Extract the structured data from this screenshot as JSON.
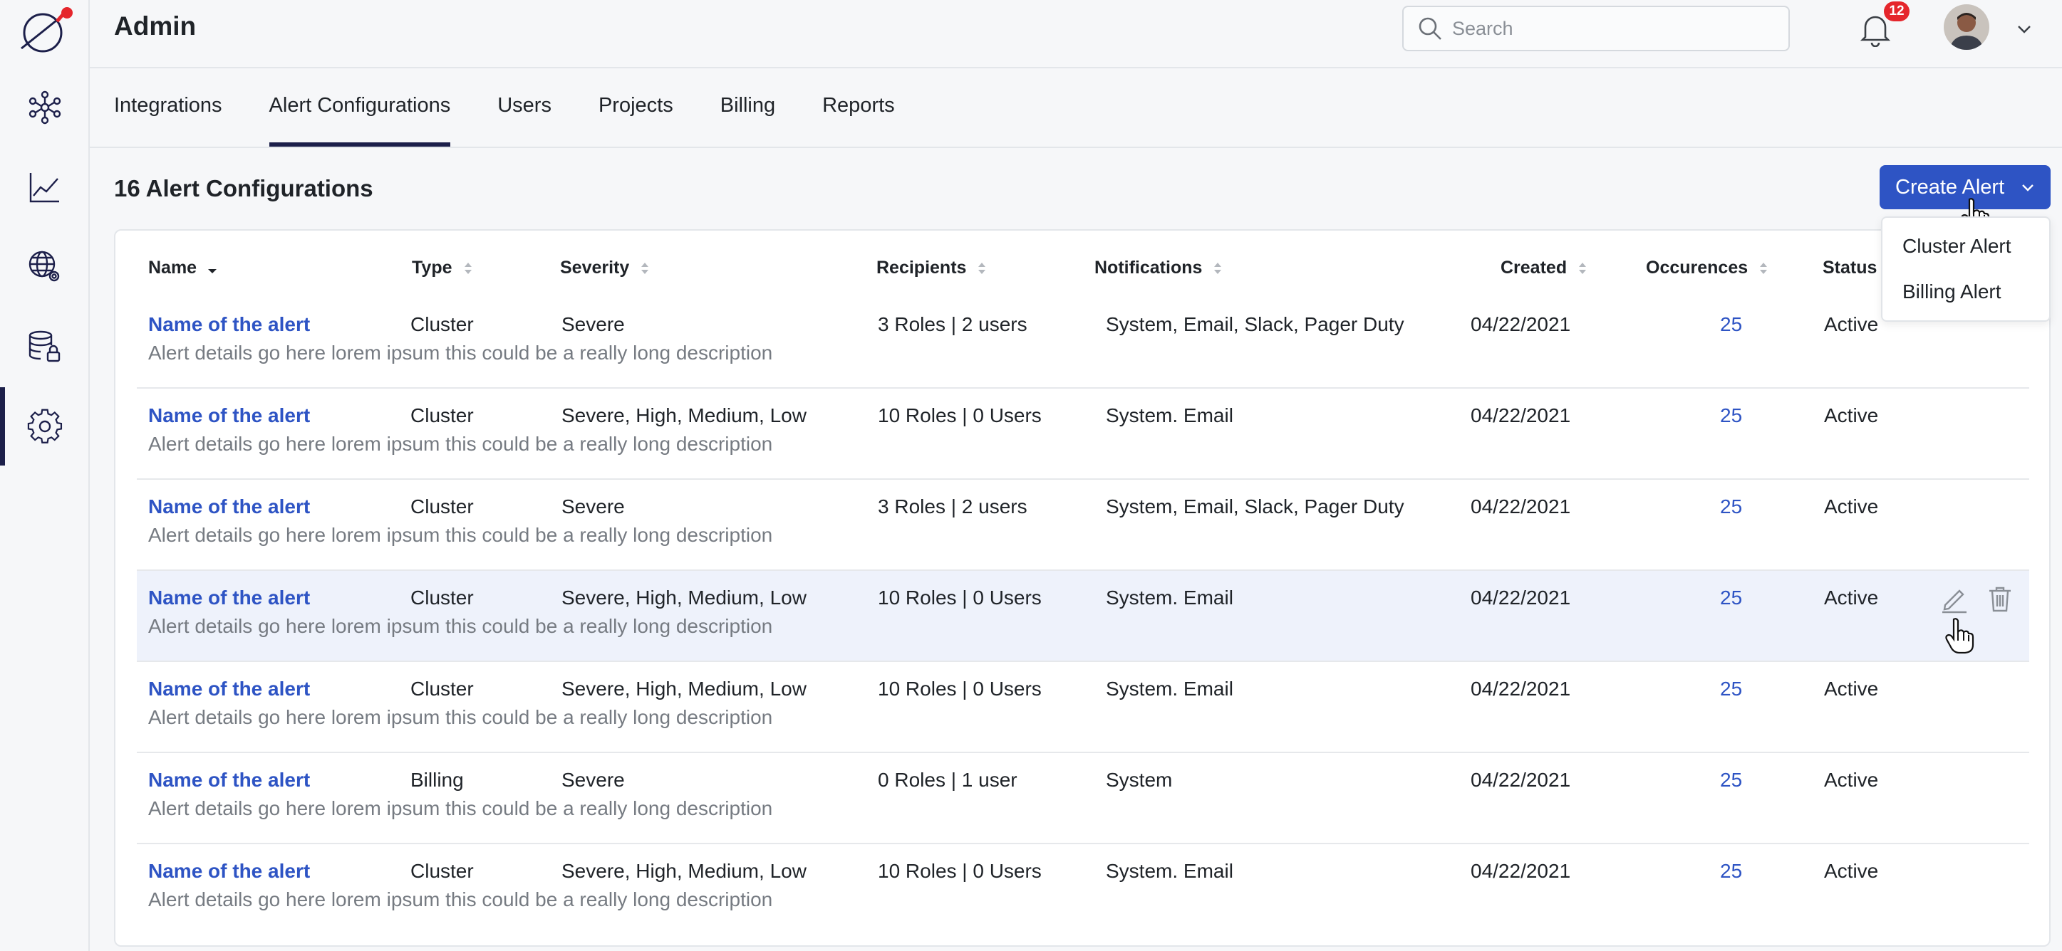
{
  "header": {
    "title": "Admin"
  },
  "search": {
    "placeholder": "Search"
  },
  "notifications": {
    "count": "12"
  },
  "tabs": [
    {
      "label": "Integrations"
    },
    {
      "label": "Alert Configurations"
    },
    {
      "label": "Users"
    },
    {
      "label": "Projects"
    },
    {
      "label": "Billing"
    },
    {
      "label": "Reports"
    }
  ],
  "section": {
    "title": "16 Alert Configurations"
  },
  "create_button": {
    "label": "Create Alert"
  },
  "create_menu": {
    "items": [
      "Cluster Alert",
      "Billing Alert"
    ]
  },
  "table": {
    "columns": [
      "Name",
      "Type",
      "Severity",
      "Recipients",
      "Notifications",
      "Created",
      "Occurences",
      "Status"
    ],
    "rows": [
      {
        "name": "Name of the alert",
        "type": "Cluster",
        "severity": "Severe",
        "recipients": "3 Roles | 2 users",
        "notifications": "System, Email, Slack, Pager Duty",
        "created": "04/22/2021",
        "occurrences": "25",
        "status": "Active",
        "description": "Alert details go here lorem ipsum this could be a really long description"
      },
      {
        "name": "Name of the alert",
        "type": "Cluster",
        "severity": "Severe, High, Medium, Low",
        "recipients": "10 Roles | 0 Users",
        "notifications": "System. Email",
        "created": "04/22/2021",
        "occurrences": "25",
        "status": "Active",
        "description": "Alert details go here lorem ipsum this could be a really long description"
      },
      {
        "name": "Name of the alert",
        "type": "Cluster",
        "severity": "Severe",
        "recipients": "3 Roles | 2 users",
        "notifications": "System, Email, Slack, Pager Duty",
        "created": "04/22/2021",
        "occurrences": "25",
        "status": "Active",
        "description": "Alert details go here lorem ipsum this could be a really long description"
      },
      {
        "name": "Name of the alert",
        "type": "Cluster",
        "severity": "Severe, High, Medium, Low",
        "recipients": "10 Roles | 0 Users",
        "notifications": "System. Email",
        "created": "04/22/2021",
        "occurrences": "25",
        "status": "Active",
        "description": "Alert details go here lorem ipsum this could be a really long description"
      },
      {
        "name": "Name of the alert",
        "type": "Cluster",
        "severity": "Severe, High, Medium, Low",
        "recipients": "10 Roles | 0 Users",
        "notifications": "System. Email",
        "created": "04/22/2021",
        "occurrences": "25",
        "status": "Active",
        "description": "Alert details go here lorem ipsum this could be a really long description"
      },
      {
        "name": "Name of the alert",
        "type": "Billing",
        "severity": "Severe",
        "recipients": "0 Roles | 1 user",
        "notifications": "System",
        "created": "04/22/2021",
        "occurrences": "25",
        "status": "Active",
        "description": "Alert details go here lorem ipsum this could be a really long description"
      },
      {
        "name": "Name of the alert",
        "type": "Cluster",
        "severity": "Severe, High, Medium, Low",
        "recipients": "10 Roles | 0 Users",
        "notifications": "System. Email",
        "created": "04/22/2021",
        "occurrences": "25",
        "status": "Active",
        "description": "Alert details go here lorem ipsum this could be a really long description"
      }
    ]
  },
  "colors": {
    "accent": "#2e54c4",
    "nav_active": "#1c1f4a",
    "badge": "#e5262c",
    "row_highlight": "#eef2fb"
  },
  "icons": [
    "logo-icon",
    "network-icon",
    "chart-icon",
    "globe-settings-icon",
    "database-lock-icon",
    "gear-icon",
    "search-icon",
    "bell-icon",
    "chevron-down-icon",
    "sort-icon",
    "edit-icon",
    "trash-icon",
    "hand-cursor-icon"
  ]
}
